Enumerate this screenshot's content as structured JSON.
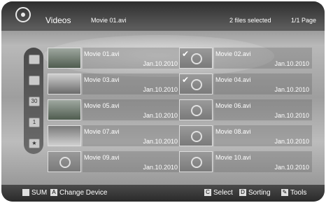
{
  "header": {
    "title": "Videos",
    "current_file": "Movie 01.avi",
    "selection_status": "2 files selected",
    "page": "1/1 Page"
  },
  "files": [
    {
      "name": "Movie 01.avi",
      "date": "Jan.10.2010",
      "selected": false,
      "thumb": "forest"
    },
    {
      "name": "Movie 02.avi",
      "date": "Jan.10.2010",
      "selected": true,
      "thumb": "reel"
    },
    {
      "name": "Movie 03.avi",
      "date": "Jan.10.2010",
      "selected": false,
      "thumb": "landscape"
    },
    {
      "name": "Movie 04.avi",
      "date": "Jan.10.2010",
      "selected": true,
      "thumb": "reel"
    },
    {
      "name": "Movie 05.avi",
      "date": "Jan.10.2010",
      "selected": false,
      "thumb": "forest"
    },
    {
      "name": "Movie 06.avi",
      "date": "Jan.10.2010",
      "selected": false,
      "thumb": "reel"
    },
    {
      "name": "Movie 07.avi",
      "date": "Jan.10.2010",
      "selected": false,
      "thumb": "flowers"
    },
    {
      "name": "Movie 08.avi",
      "date": "Jan.10.2010",
      "selected": false,
      "thumb": "reel"
    },
    {
      "name": "Movie 09.avi",
      "date": "Jan.10.2010",
      "selected": false,
      "thumb": "reel"
    },
    {
      "name": "Movie 10.avi",
      "date": "Jan.10.2010",
      "selected": false,
      "thumb": "reel"
    }
  ],
  "sidebar": {
    "items": [
      {
        "icon": "folder-icon",
        "label": ""
      },
      {
        "icon": "image-icon",
        "label": ""
      },
      {
        "icon": "calendar-icon",
        "label": "30"
      },
      {
        "icon": "number-icon",
        "label": "1"
      },
      {
        "icon": "star-icon",
        "label": ""
      }
    ]
  },
  "footer": {
    "sum_label": "SUM",
    "change_device_key": "A",
    "change_device_label": "Change Device",
    "select_key": "C",
    "select_label": "Select",
    "sorting_key": "D",
    "sorting_label": "Sorting",
    "tools_label": "Tools"
  }
}
